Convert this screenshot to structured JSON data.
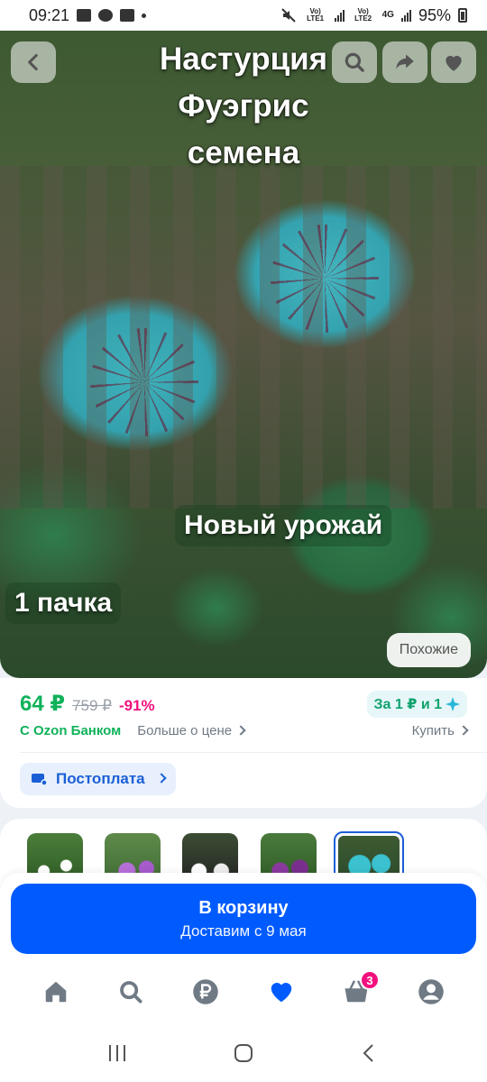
{
  "status_bar": {
    "time": "09:21",
    "sim1": "Vo) LTE1",
    "sim2": "Vo) LTE2",
    "network": "4G",
    "battery": "95%"
  },
  "hero": {
    "title_lines": [
      "Настурция",
      "Фуэгрис",
      "семена"
    ],
    "harvest_label": "Новый урожай",
    "pack_label": "1 пачка",
    "similar_button": "Похожие"
  },
  "price": {
    "current": "64 ₽",
    "old": "759 ₽",
    "discount": "-91%",
    "bank_promo": "За 1 ₽ и 1",
    "bank_label": "С Ozon Банком",
    "more_price": "Больше о цене",
    "buy_link": "Купить",
    "postpay_label": "Постоплата"
  },
  "cart": {
    "button_label": "В корзину",
    "delivery": "Доставим с 9 мая"
  },
  "nav": {
    "cart_badge": "3"
  },
  "colors": {
    "accent_blue": "#005bff",
    "price_green": "#10b25a",
    "discount_pink": "#f1117e"
  }
}
